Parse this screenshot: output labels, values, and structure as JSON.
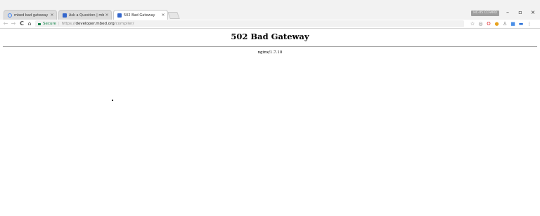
{
  "browser": {
    "tabs": [
      {
        "title": "mbed bad gateway - Go",
        "active": false
      },
      {
        "title": "Ask a Question | mbed",
        "active": false
      },
      {
        "title": "502 Bad Gateway",
        "active": true
      }
    ],
    "close_glyph": "×",
    "profile_label": "HC-05 CCFARD",
    "window_controls": {
      "minimize": "–",
      "maximize": "▫",
      "close": "×"
    },
    "nav": {
      "back": "←",
      "forward": "→",
      "reload": "C",
      "home": "⌂"
    },
    "omnibox": {
      "security_label": "Secure",
      "url_scheme": "https://",
      "url_host": "developer.mbed.org",
      "url_path": "/compiler/"
    },
    "extensions": [
      {
        "name": "star-icon",
        "glyph": "☆",
        "color": "#666666"
      },
      {
        "name": "circle-extension-icon",
        "glyph": "◎",
        "color": "#777777"
      },
      {
        "name": "opera-icon",
        "glyph": "O",
        "color": "#e0262a"
      },
      {
        "name": "chrome-icon",
        "glyph": "●",
        "color": "#e8a21d"
      },
      {
        "name": "user-extension-icon",
        "glyph": "♙",
        "color": "#888888"
      },
      {
        "name": "blue-square-extension-icon",
        "glyph": "■",
        "color": "#4a8fe7"
      },
      {
        "name": "cast-extension-icon",
        "glyph": "▬",
        "color": "#2a6fd6"
      },
      {
        "name": "menu-icon",
        "glyph": "⋮",
        "color": "#555555"
      }
    ]
  },
  "page": {
    "heading": "502 Bad Gateway",
    "server": "nginx/1.7.10"
  }
}
